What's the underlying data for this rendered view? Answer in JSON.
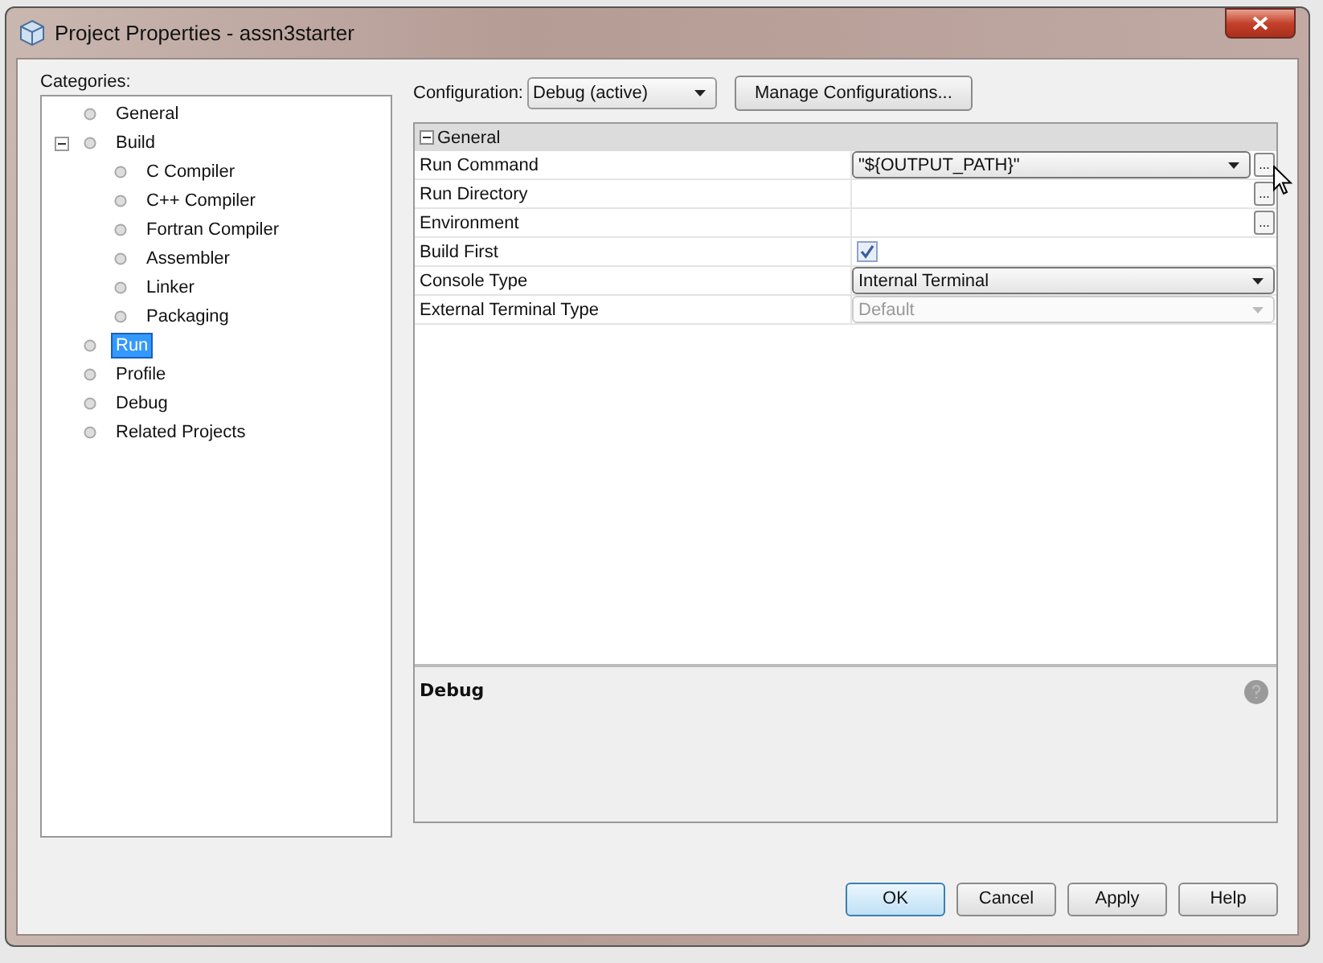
{
  "window": {
    "title": "Project Properties - assn3starter"
  },
  "categories": {
    "label": "Categories:",
    "items": [
      {
        "label": "General",
        "selected": false
      },
      {
        "label": "Build",
        "selected": false,
        "expanded": true,
        "children": [
          {
            "label": "C Compiler",
            "selected": false
          },
          {
            "label": "C++ Compiler",
            "selected": false
          },
          {
            "label": "Fortran Compiler",
            "selected": false
          },
          {
            "label": "Assembler",
            "selected": false
          },
          {
            "label": "Linker",
            "selected": false
          },
          {
            "label": "Packaging",
            "selected": false
          }
        ]
      },
      {
        "label": "Run",
        "selected": true
      },
      {
        "label": "Profile",
        "selected": false
      },
      {
        "label": "Debug",
        "selected": false
      },
      {
        "label": "Related Projects",
        "selected": false
      }
    ]
  },
  "configuration": {
    "label": "Configuration:",
    "value": "Debug (active)",
    "button": "Manage Configurations..."
  },
  "property_sheet": {
    "section": "General",
    "expanded": true,
    "rows": [
      {
        "name": "Run Command",
        "kind": "combo",
        "value": "\"${OUTPUT_PATH}\"",
        "disabled": false,
        "button": "..."
      },
      {
        "name": "Run Directory",
        "kind": "text",
        "button": "..."
      },
      {
        "name": "Environment",
        "kind": "text",
        "button": "..."
      },
      {
        "name": "Build First",
        "kind": "checkbox",
        "checked": true
      },
      {
        "name": "Console Type",
        "kind": "combo",
        "value": "Internal Terminal",
        "disabled": false
      },
      {
        "name": "External Terminal Type",
        "kind": "combo",
        "value": "Default",
        "disabled": true
      }
    ]
  },
  "description": {
    "title": "Debug"
  },
  "buttons": [
    {
      "label": "OK",
      "default": true
    },
    {
      "label": "Cancel",
      "default": false
    },
    {
      "label": "Apply",
      "default": false
    },
    {
      "label": "Help",
      "default": false
    }
  ]
}
